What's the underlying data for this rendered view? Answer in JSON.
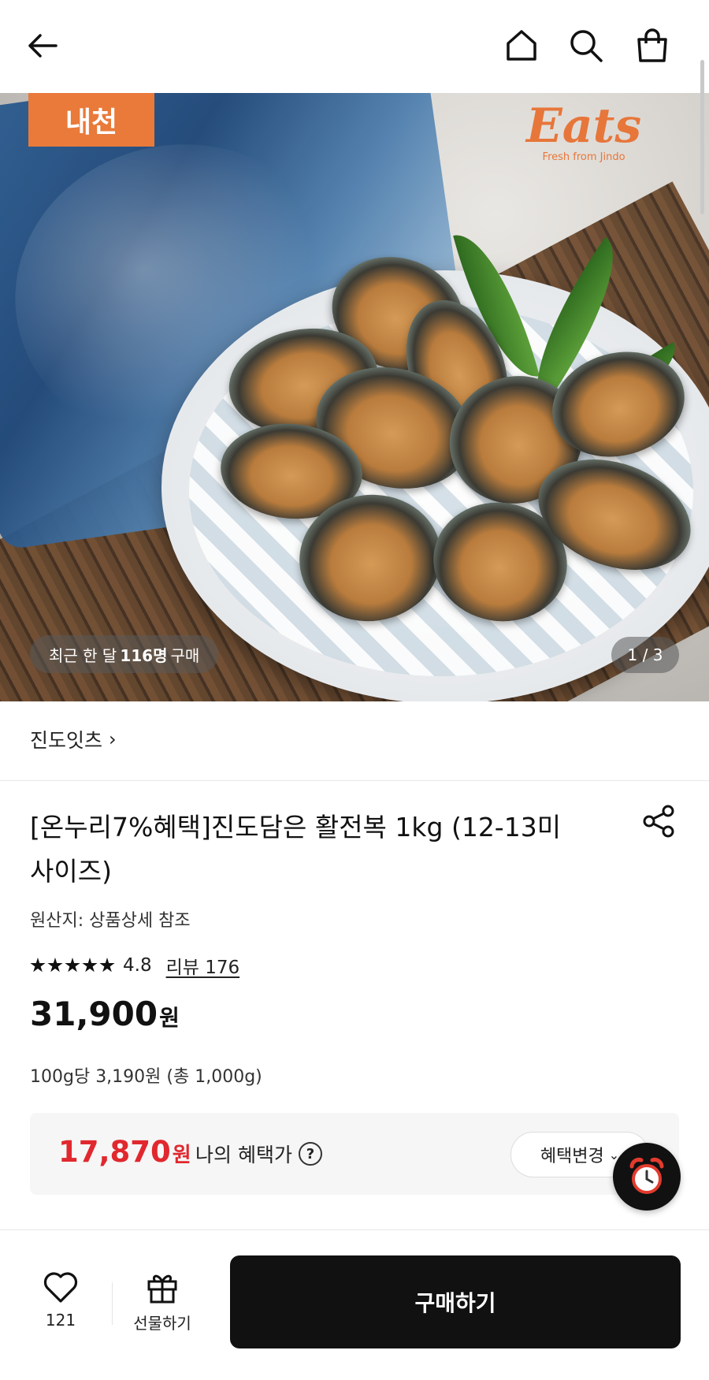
{
  "hero": {
    "brand_tag": "내천",
    "logo_word": "Eats",
    "logo_tagline": "Fresh from Jindo",
    "recent_prefix": "최근 한 달",
    "recent_count": "116명",
    "recent_suffix": "구매",
    "pager": "1 / 3"
  },
  "seller": {
    "name": "진도잇츠",
    "chevron": "›"
  },
  "product": {
    "title": "[온누리7%혜택]진도담은 활전복 1kg (12-13미 사이즈)",
    "origin": "원산지: 상품상세 참조",
    "rating_value": "4.8",
    "rating_stars": 5,
    "review_label": "리뷰 176",
    "price": "31,900",
    "price_unit": "원",
    "unit_price": "100g당 3,190원 (총 1,000g)"
  },
  "benefit": {
    "price": "17,870",
    "price_unit": "원",
    "label": "나의 혜택가",
    "help": "?",
    "change_label": "혜택변경",
    "change_caret": "⌄"
  },
  "bottom": {
    "wish_count": "121",
    "gift_label": "선물하기",
    "buy_label": "구매하기"
  },
  "icons": [
    "back-arrow-icon",
    "home-icon",
    "search-icon",
    "shopping-bag-icon",
    "share-icon",
    "heart-icon",
    "gift-icon",
    "alarm-clock-icon"
  ]
}
